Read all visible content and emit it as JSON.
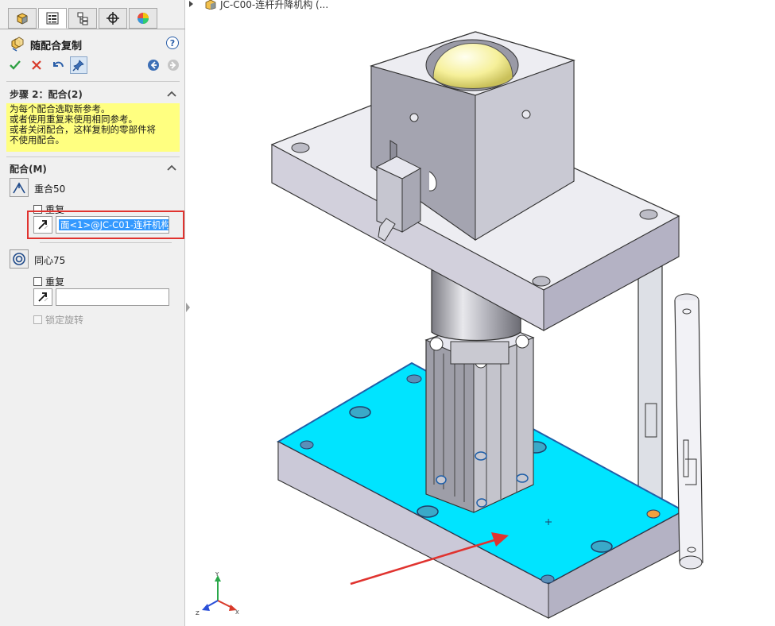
{
  "tabs": [
    {
      "name": "feature-manager",
      "icon": "feature-tree-icon"
    },
    {
      "name": "property-manager",
      "icon": "property-list-icon"
    },
    {
      "name": "configuration-manager",
      "icon": "configuration-icon"
    },
    {
      "name": "dimxpert-manager",
      "icon": "crosshair-icon"
    },
    {
      "name": "display-manager",
      "icon": "appearance-pie-icon"
    }
  ],
  "pm": {
    "title": "随配合复制",
    "help": "?",
    "actions": [
      "ok-check",
      "cancel-x",
      "undo",
      "pushpin",
      "back",
      "forward"
    ]
  },
  "step": {
    "title": "步骤 2：配合(2)",
    "message_lines": [
      "为每个配合选取新参考。",
      "或者使用重复来使用相同参考。",
      "或者关闭配合，这样复制的零部件将",
      "不使用配合。"
    ]
  },
  "mates": {
    "title": "配合(M)",
    "items": [
      {
        "label": "重合50",
        "icon": "coincident-icon",
        "repeat_label": "重复",
        "reference": "面<1>@JC-C01-连杆机构",
        "selected": true
      },
      {
        "label": "同心75",
        "icon": "concentric-icon",
        "repeat_label": "重复",
        "reference": "",
        "selected": false
      }
    ],
    "lock_rotation": "锁定旋转"
  },
  "tree": {
    "label": "JC-C00-连杆升降机构  (..."
  },
  "triad": {
    "x": "X",
    "y": "Y",
    "z": "Z"
  },
  "colors": {
    "highlight_face": "#00e4ff",
    "callout_red": "#e0332f",
    "message_bg": "#ffff80"
  }
}
